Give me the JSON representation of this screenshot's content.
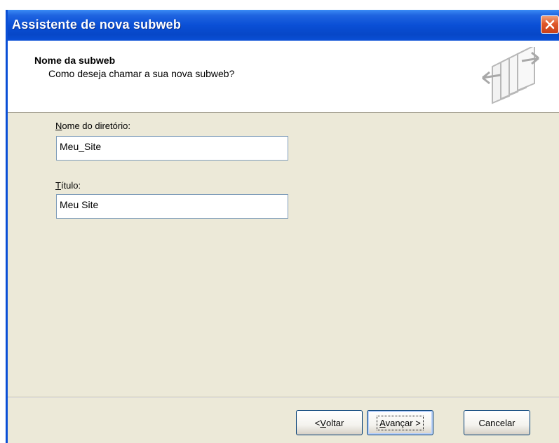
{
  "window": {
    "title": "Assistente de nova subweb",
    "close_icon": "close-icon"
  },
  "header": {
    "title": "Nome da subweb",
    "subtitle": "Como deseja chamar a sua nova subweb?",
    "icon": "pages-icon"
  },
  "fields": {
    "directory": {
      "label_accel": "N",
      "label_rest": "ome do diretório:",
      "value": "Meu_Site"
    },
    "title": {
      "label_accel": "T",
      "label_rest": "ítulo:",
      "value": "Meu Site"
    }
  },
  "buttons": {
    "back": {
      "prefix": "< ",
      "accel": "V",
      "rest": "oltar"
    },
    "next": {
      "accel": "A",
      "rest": "vançar >"
    },
    "cancel": {
      "label": "Cancelar"
    }
  },
  "colors": {
    "titlebar": "#0a4fd6",
    "dialog_bg": "#ece9d8",
    "close_button": "#e0572a"
  }
}
